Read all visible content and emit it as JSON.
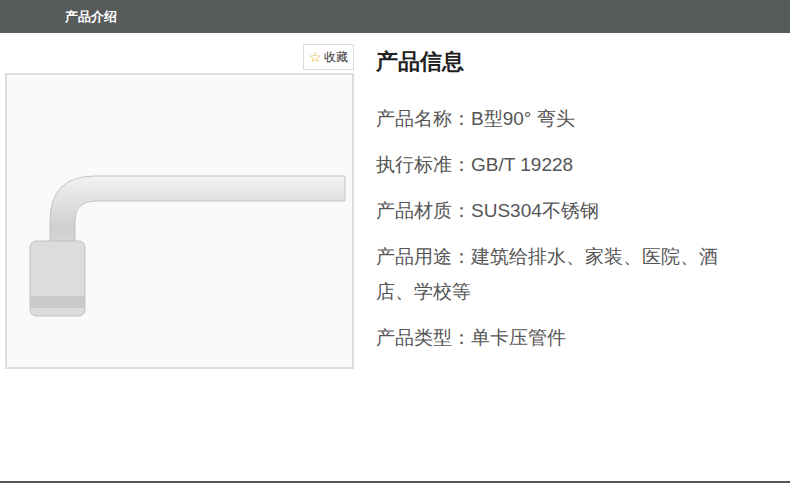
{
  "header": {
    "title": "产品介绍"
  },
  "favorite": {
    "icon": "☆",
    "label": "收藏"
  },
  "info": {
    "title": "产品信息",
    "rows": [
      {
        "label": "产品名称：",
        "value": "B型90° 弯头"
      },
      {
        "label": "执行标准：",
        "value": "GB/T 19228"
      },
      {
        "label": "产品材质：",
        "value": "SUS304不锈钢"
      },
      {
        "label": "产品用途：",
        "value": "建筑给排水、家装、医院、酒店、学校等"
      },
      {
        "label": "产品类型：",
        "value": "单卡压管件"
      }
    ]
  }
}
